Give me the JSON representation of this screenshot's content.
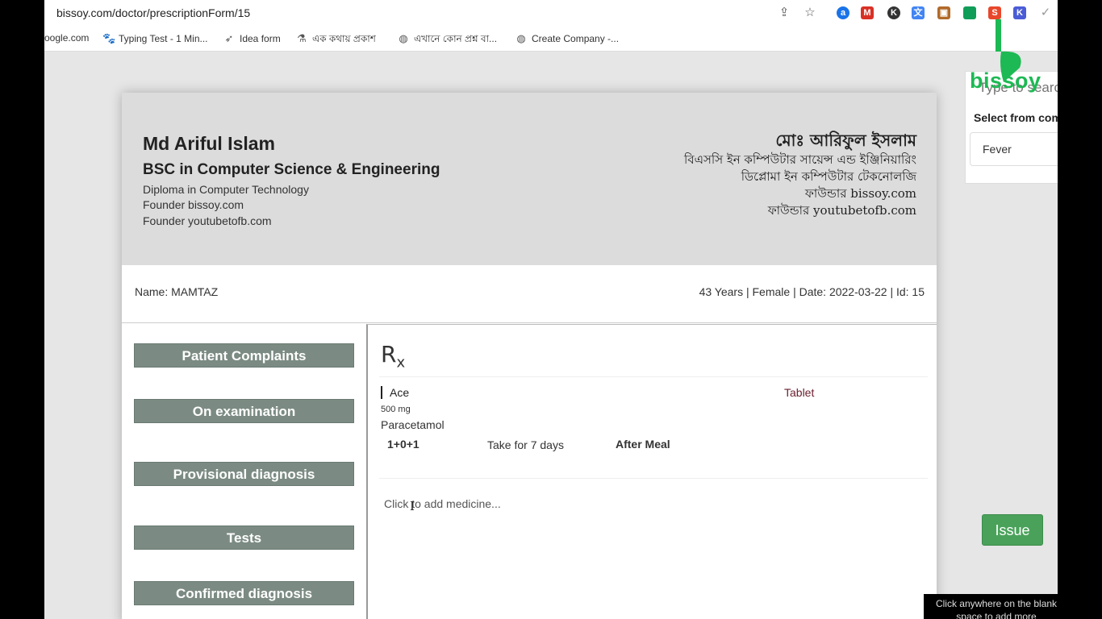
{
  "browser": {
    "url": "bissoy.com/doctor/prescriptionForm/15",
    "bookmarks": [
      {
        "label": "oogle.com",
        "icon": "google-icon"
      },
      {
        "label": "Typing Test - 1 Min...",
        "icon": "paw-icon"
      },
      {
        "label": "Idea form",
        "icon": "rocket-icon"
      },
      {
        "label": "এক কথায় প্রকাশ",
        "icon": "flask-icon"
      },
      {
        "label": "এখানে কোন প্রশ্ন বা...",
        "icon": "globe-icon"
      },
      {
        "label": "Create Company -...",
        "icon": "globe-icon"
      }
    ]
  },
  "doctor": {
    "name_en": "Md Ariful Islam",
    "degree_en": "BSC in Computer Science & Engineering",
    "lines_en": [
      "Diploma in Computer Technology",
      "Founder bissoy.com",
      "Founder youtubetofb.com"
    ],
    "name_bn": "মোঃ আরিফুল ইসলাম",
    "lines_bn": [
      "বিএসসি ইন কম্পিউটার সায়েন্স এন্ড ইঞ্জিনিয়ারিং",
      "ডিপ্লোমা ইন কম্পিউটার টেকনোলজি",
      "ফাউন্ডার bissoy.com",
      "ফাউন্ডার youtubetofb.com"
    ]
  },
  "patient": {
    "name_label": "Name: MAMTAZ",
    "info": "43 Years | Female | Date: 2022-03-22 | Id: 15"
  },
  "sections": [
    "Patient Complaints",
    "On examination",
    "Provisional diagnosis",
    "Tests",
    "Confirmed diagnosis"
  ],
  "rx": {
    "symbol": "R",
    "symbol_sub": "x",
    "medicine": {
      "name": "Ace",
      "form": "Tablet",
      "strength": "500 mg",
      "generic": "Paracetamol",
      "dose": "1+0+1",
      "duration": "Take for  7 days",
      "timing": "After Meal"
    },
    "add_placeholder": "Click to add medicine..."
  },
  "brand": {
    "logo_text": "bissoy",
    "color": "#1db954"
  },
  "search": {
    "placeholder": "Type to search",
    "select_label": "Select from com",
    "selected": "Fever"
  },
  "issue_label": "Issue",
  "hint": "Click anywhere on the blank space to add more"
}
